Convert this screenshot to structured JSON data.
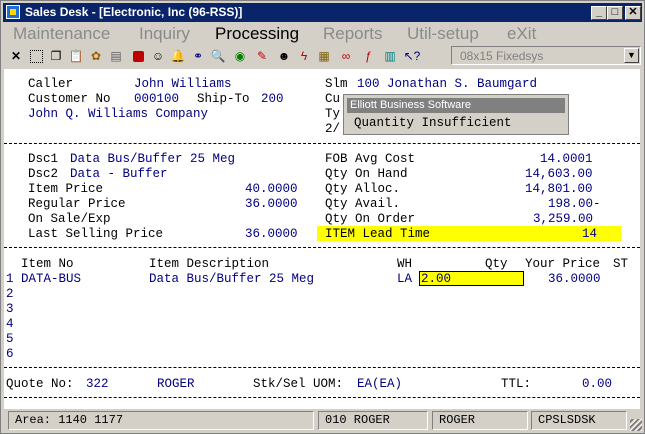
{
  "window": {
    "title": "Sales Desk - [Electronic, Inc (96-RSS)]"
  },
  "menu": [
    {
      "label": "Maintenance",
      "active": false
    },
    {
      "label": "Inquiry",
      "active": false
    },
    {
      "label": "Processing",
      "active": true
    },
    {
      "label": "Reports",
      "active": false
    },
    {
      "label": "Util-setup",
      "active": false
    },
    {
      "label": "eXit",
      "active": false
    }
  ],
  "toolbar": {
    "icons": [
      "close-x-icon",
      "select-icon",
      "copy-icon",
      "paste-icon",
      "settings-icon",
      "print-preview-icon",
      "stop-icon",
      "user-icon",
      "bell-icon",
      "binoculars-icon",
      "magnifier-icon",
      "globe-icon",
      "pen-icon",
      "contact-icon",
      "lightning-icon",
      "calculator-icon",
      "link-icon",
      "function-icon",
      "document-icon",
      "help-pointer-icon"
    ],
    "font_select": "08x15 Fixedsys"
  },
  "header": {
    "caller_label": "Caller",
    "caller": "John Williams",
    "customer_no_label": "Customer No",
    "customer_no": "000100",
    "ship_to_label": "Ship-To",
    "ship_to": "200",
    "company": "John Q. Williams Company",
    "slm_label": "Slm",
    "slm": "100 Jonathan S. Baumgard",
    "cu_partial": "Cu",
    "ty_partial": "Ty",
    "date_partial": "2/"
  },
  "item_info": {
    "dsc1_label": "Dsc1",
    "dsc1": "Data Bus/Buffer 25 Meg",
    "dsc2_label": "Dsc2",
    "dsc2": "Data - Buffer",
    "item_price_label": "Item Price",
    "item_price": "40.0000",
    "regular_price_label": "Regular Price",
    "regular_price": "36.0000",
    "on_sale_label": "On Sale/Exp",
    "last_selling_label": "Last Selling Price",
    "last_selling": "36.0000",
    "fob_label": "FOB Avg Cost",
    "fob": "14.0001",
    "on_hand_label": "Qty On Hand",
    "on_hand": "14,603.00",
    "alloc_label": "Qty Alloc.",
    "alloc": "14,801.00",
    "avail_label": "Qty Avail.",
    "avail": "198.00-",
    "on_order_label": "Qty On Order",
    "on_order": "3,259.00",
    "lead_time_label": "ITEM Lead Time",
    "lead_time": "14"
  },
  "grid": {
    "headers": {
      "item_no": "Item No",
      "desc": "Item Description",
      "wh": "WH",
      "qty": "Qty",
      "price": "Your Price",
      "st": "ST"
    },
    "row1": {
      "num": "1",
      "item_no": "DATA-BUS",
      "desc": "Data Bus/Buffer 25 Meg",
      "wh": "LA",
      "qty": "2.00",
      "price": "36.0000"
    },
    "row_numbers": [
      "2",
      "3",
      "4",
      "5",
      "6"
    ]
  },
  "footer": {
    "quote_label": "Quote No:",
    "quote": "322",
    "user": "ROGER",
    "uom_label": "Stk/Sel UOM:",
    "uom": "EA(EA)",
    "ttl_label": "TTL:",
    "ttl": "0.00"
  },
  "popup": {
    "title": "Elliott Business Software",
    "message": "Quantity Insufficient"
  },
  "status": {
    "area": "Area: 1140 1177",
    "user_code": "010 ROGER",
    "user": "ROGER",
    "program": "CPSLSDSK"
  }
}
